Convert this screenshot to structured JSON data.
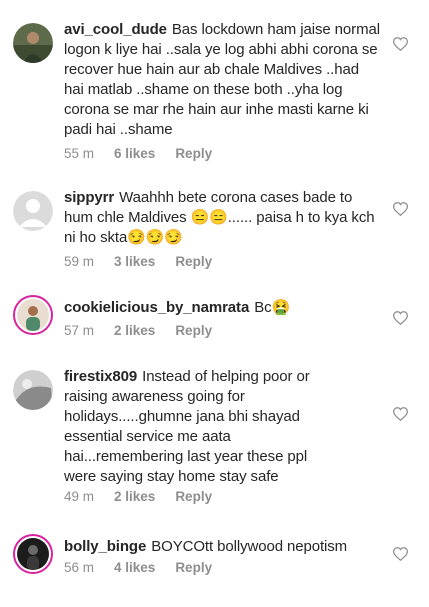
{
  "comments": [
    {
      "username": "avi_cool_dude",
      "text": "Bas lockdown ham jaise normal logon k liye hai ..sala ye log abhi abhi corona se recover hue hain aur ab chale Maldives ..had hai matlab ..shame on these both ..yha log corona se mar rhe hain aur inhe masti karne ki padi hai ..shame",
      "time": "55 m",
      "likes": "6 likes",
      "reply": "Reply",
      "avatar_icon": "user-photo-avatar"
    },
    {
      "username": "sippyrr",
      "text": "Waahhh bete corona cases bade to hum chle Maldives 😑😑...... paisa h to kya kch ni ho skta😏😏😏",
      "time": "59 m",
      "likes": "3 likes",
      "reply": "Reply",
      "avatar_icon": "default-avatar"
    },
    {
      "username": "cookielicious_by_namrata",
      "text": "Bc🤮",
      "time": "57 m",
      "likes": "2 likes",
      "reply": "Reply",
      "avatar_icon": "story-ring-avatar"
    },
    {
      "username": "firestix809",
      "text": "Instead of helping poor or raising awareness going for holidays.....ghumne jana bhi shayad essential service me aata hai...remembering last year these ppl were saying stay home stay safe",
      "time": "49 m",
      "likes": "2 likes",
      "reply": "Reply",
      "avatar_icon": "user-photo-avatar"
    },
    {
      "username": "bolly_binge",
      "text": "BOYCOtt bollywood nepotism",
      "time": "56 m",
      "likes": "4 likes",
      "reply": "Reply",
      "avatar_icon": "story-ring-avatar"
    }
  ]
}
